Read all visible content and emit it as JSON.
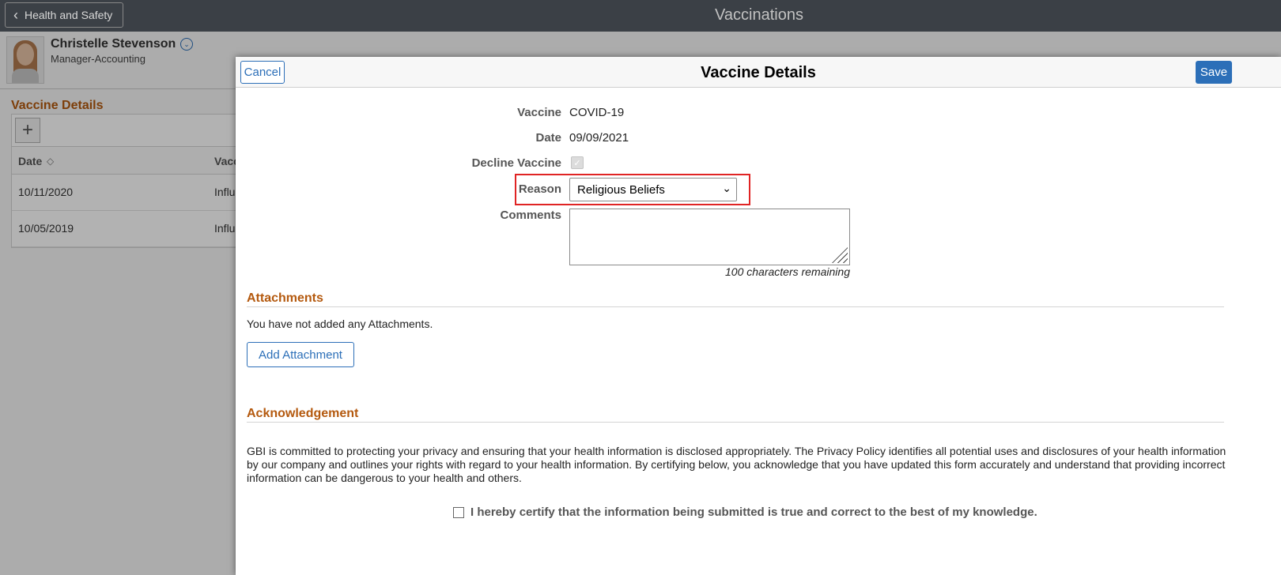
{
  "banner": {
    "back_label": "Health and Safety",
    "title": "Vaccinations"
  },
  "employee": {
    "name": "Christelle Stevenson",
    "role": "Manager-Accounting"
  },
  "background": {
    "section_title": "Vaccine Details",
    "add_symbol": "+",
    "columns": [
      "Date",
      "Vacc"
    ],
    "rows": [
      {
        "date": "10/11/2020",
        "vaccine": "Influ"
      },
      {
        "date": "10/05/2019",
        "vaccine": "Influ"
      }
    ]
  },
  "modal": {
    "title": "Vaccine Details",
    "cancel_label": "Cancel",
    "save_label": "Save",
    "fields": {
      "vaccine_label": "Vaccine",
      "vaccine_value": "COVID-19",
      "date_label": "Date",
      "date_value": "09/09/2021",
      "decline_label": "Decline Vaccine",
      "decline_checked": true,
      "reason_label": "Reason",
      "reason_value": "Religious Beliefs",
      "comments_label": "Comments",
      "comments_value": "",
      "chars_remaining": "100 characters remaining"
    },
    "attachments": {
      "title": "Attachments",
      "empty_text": "You have not added any Attachments.",
      "add_label": "Add Attachment"
    },
    "acknowledgement": {
      "title": "Acknowledgement",
      "text": "GBI is committed to protecting your privacy and ensuring that your health information is disclosed appropriately. The Privacy Policy identifies all potential uses and disclosures of your health information by our company and outlines your rights with regard to your health information. By certifying below, you acknowledge that you have updated this form accurately and understand that providing incorrect information can be dangerous to your health and others.",
      "certify_label": "I hereby certify that the information being submitted is true and correct to the best of my knowledge."
    }
  },
  "colors": {
    "accent": "#2c6fb8",
    "section_title": "#b4590e",
    "highlight": "#e02424",
    "banner": "#3b4046"
  },
  "icons": [
    "chevron-left-icon",
    "chevron-down-circle-icon",
    "plus-icon",
    "sort-icon",
    "select-caret-icon",
    "checkmark-icon",
    "resize-grip-icon"
  ]
}
